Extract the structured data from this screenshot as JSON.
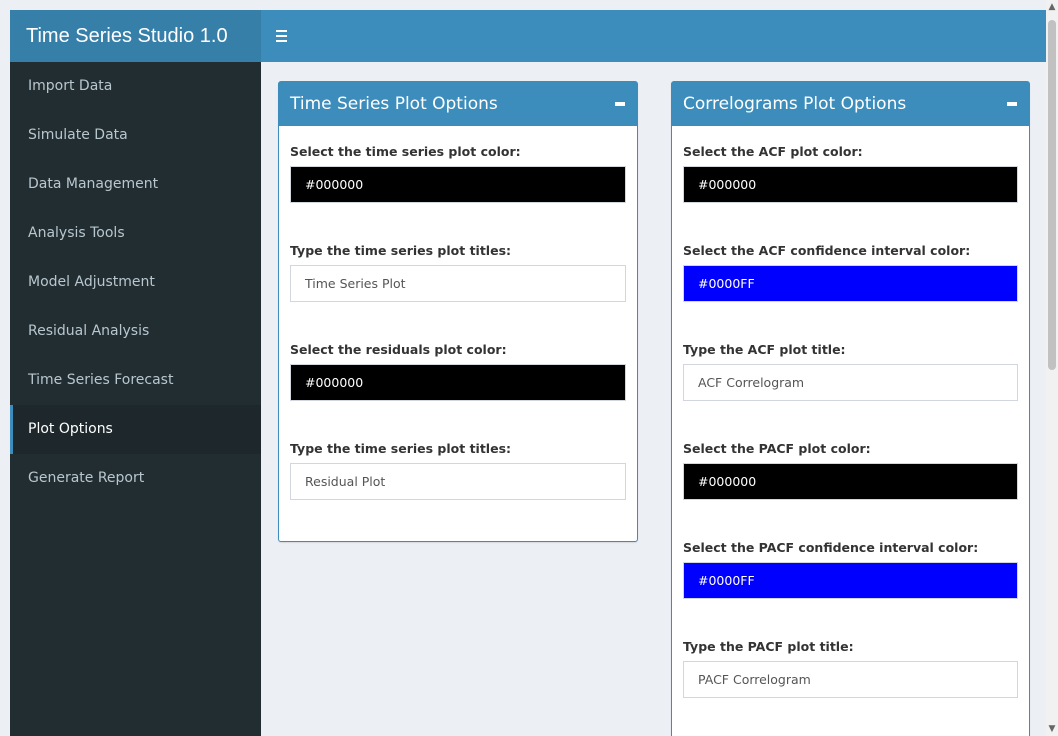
{
  "app": {
    "title": "Time Series Studio 1.0"
  },
  "sidebar": {
    "items": [
      {
        "label": "Import Data"
      },
      {
        "label": "Simulate Data"
      },
      {
        "label": "Data Management"
      },
      {
        "label": "Analysis Tools"
      },
      {
        "label": "Model Adjustment"
      },
      {
        "label": "Residual Analysis"
      },
      {
        "label": "Time Series Forecast"
      },
      {
        "label": "Plot Options",
        "active": true
      },
      {
        "label": "Generate Report"
      }
    ]
  },
  "ts_box": {
    "title": "Time Series Plot Options",
    "fields": [
      {
        "label": "Select the time series plot color:",
        "value": "#000000",
        "type": "color"
      },
      {
        "label": "Type the time series plot titles:",
        "value": "Time Series Plot",
        "type": "text"
      },
      {
        "label": "Select the residuals plot color:",
        "value": "#000000",
        "type": "color"
      },
      {
        "label": "Type the time series plot titles:",
        "value": "Residual Plot",
        "type": "text"
      }
    ]
  },
  "corr_box": {
    "title": "Correlograms Plot Options",
    "fields": [
      {
        "label": "Select the ACF plot color:",
        "value": "#000000",
        "type": "color"
      },
      {
        "label": "Select the ACF confidence interval color:",
        "value": "#0000FF",
        "type": "color"
      },
      {
        "label": "Type the ACF plot title:",
        "value": "ACF Correlogram",
        "type": "text"
      },
      {
        "label": "Select the PACF plot color:",
        "value": "#000000",
        "type": "color"
      },
      {
        "label": "Select the PACF confidence interval color:",
        "value": "#0000FF",
        "type": "color"
      },
      {
        "label": "Type the PACF plot title:",
        "value": "PACF Correlogram",
        "type": "text"
      }
    ]
  },
  "colors": {
    "header": "#3c8dbc",
    "logo": "#367fa9",
    "sidebar": "#222d32",
    "sidebar_active": "#1e282c"
  },
  "icons": {
    "menu": "hamburger-menu-icon",
    "collapse": "minus-icon"
  }
}
